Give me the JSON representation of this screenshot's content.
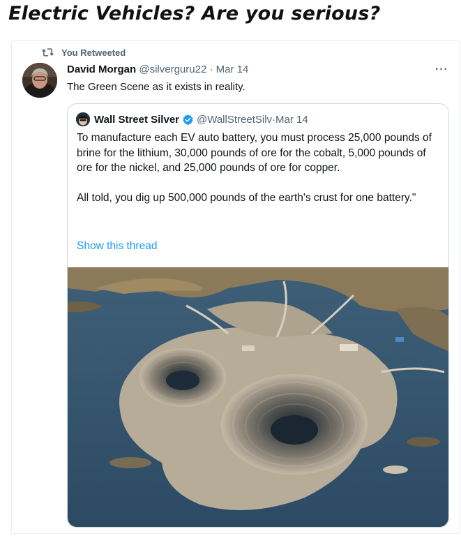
{
  "headline": "Electric Vehicles? Are you serious?",
  "retweet_notice": "You Retweeted",
  "tweet": {
    "author_name": "David Morgan",
    "author_handle": "@silverguru22",
    "separator": " · ",
    "date": "Mar 14",
    "text": "The Green Scene as it exists in reality.",
    "more_icon": "more-horizontal-icon"
  },
  "quoted_tweet": {
    "author_name": "Wall Street Silver",
    "verified_icon": "verified-badge-icon",
    "author_handle": "@WallStreetSilv",
    "separator": " · ",
    "date": "Mar 14",
    "paragraph_1": "To manufacture each EV auto battery, you must process 25,000 pounds of brine for the lithium, 30,000 pounds of ore for the cobalt, 5,000 pounds of ore for the nickel, and 25,000 pounds of ore for copper.",
    "paragraph_2": "All told, you dig up 500,000 pounds of the earth's crust for one battery.\"",
    "show_thread": "Show this thread"
  },
  "colors": {
    "accent": "#1d9bf0",
    "secondary_text": "#536471",
    "border": "#cfd9de"
  }
}
